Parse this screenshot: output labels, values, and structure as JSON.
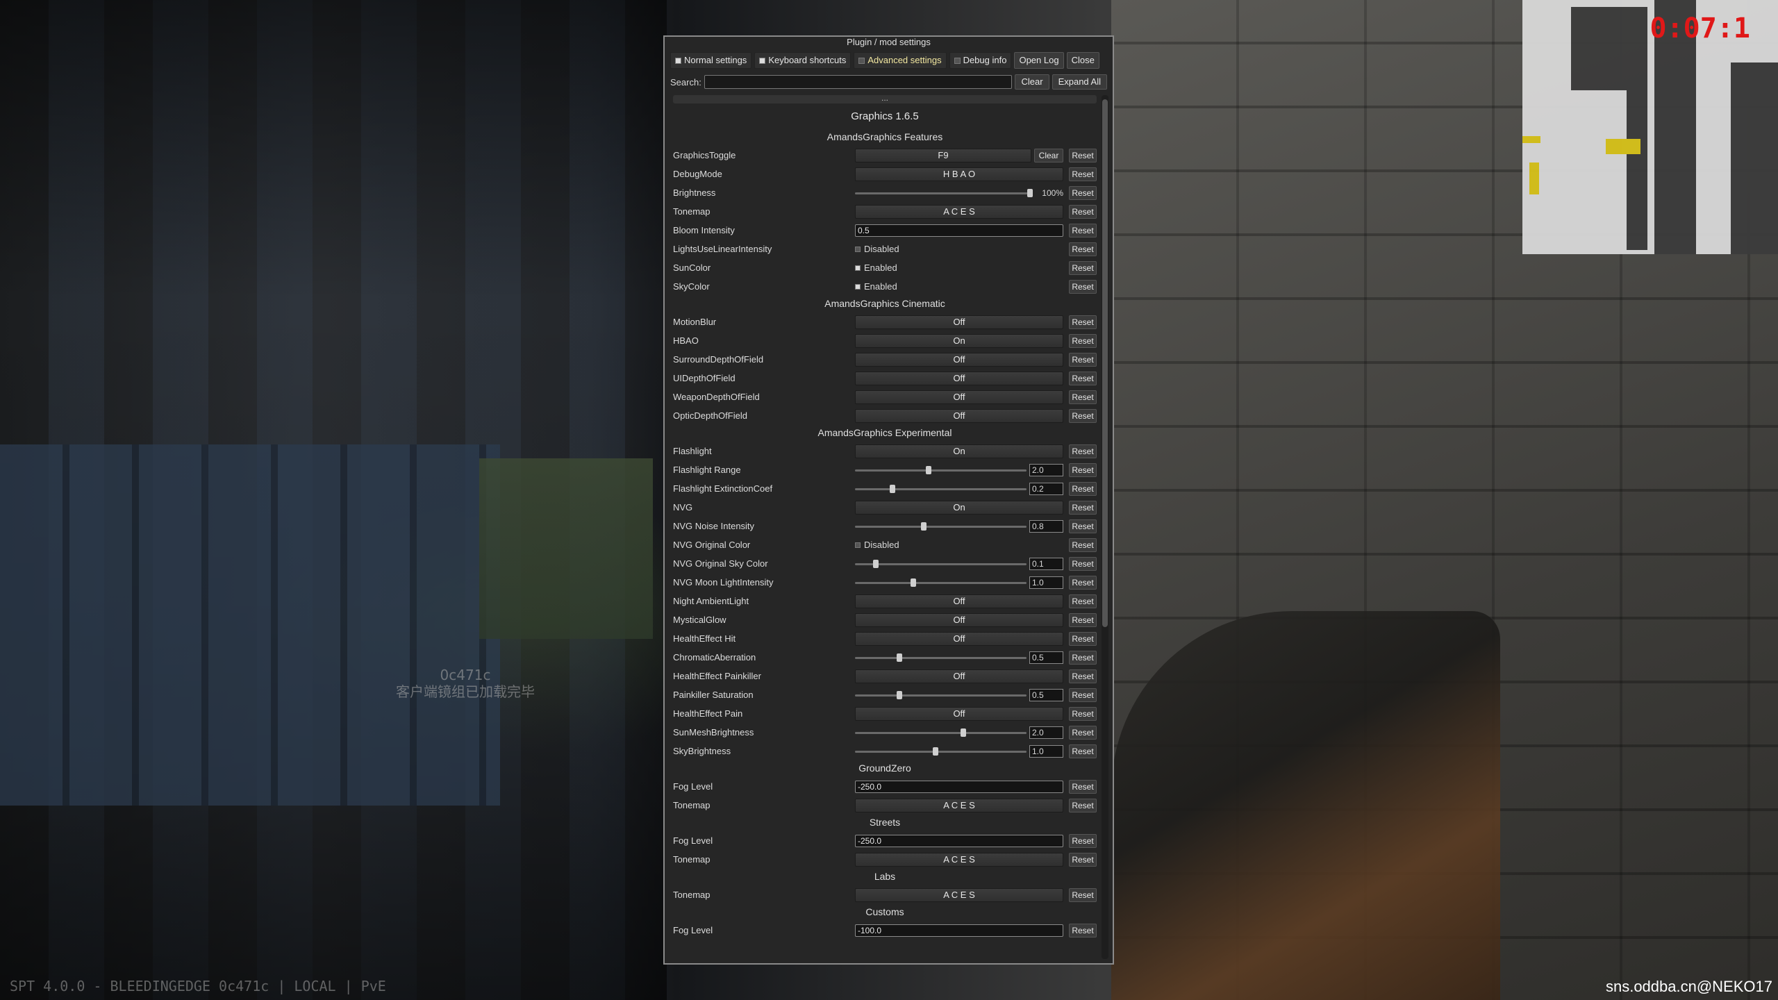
{
  "window": {
    "title": "Plugin / mod settings"
  },
  "tabs": [
    {
      "label": "Normal settings",
      "checked": true,
      "active": false
    },
    {
      "label": "Keyboard shortcuts",
      "checked": true,
      "active": false
    },
    {
      "label": "Advanced settings",
      "checked": false,
      "active": true
    },
    {
      "label": "Debug info",
      "checked": false,
      "active": false
    }
  ],
  "buttons": {
    "open_log": "Open Log",
    "close": "Close",
    "clear": "Clear",
    "expand_all": "Expand All",
    "reset": "Reset"
  },
  "search": {
    "label": "Search:",
    "value": ""
  },
  "plugin_title": "Graphics 1.6.5",
  "dots": "...",
  "sections": [
    {
      "title": "AmandsGraphics Features",
      "rows": [
        {
          "label": "GraphicsToggle",
          "type": "key",
          "value": "F9",
          "clear": "Clear"
        },
        {
          "label": "DebugMode",
          "type": "dropdown",
          "value": "H B A O"
        },
        {
          "label": "Brightness",
          "type": "slider",
          "value": 1.0,
          "display": "100%",
          "mode": "pct"
        },
        {
          "label": "Tonemap",
          "type": "dropdown",
          "value": "A C E S"
        },
        {
          "label": "Bloom Intensity",
          "type": "text",
          "value": "0.5"
        },
        {
          "label": "LightsUseLinearIntensity",
          "type": "check",
          "checked": false,
          "value": "Disabled"
        },
        {
          "label": "SunColor",
          "type": "check",
          "checked": true,
          "value": "Enabled"
        },
        {
          "label": "SkyColor",
          "type": "check",
          "checked": true,
          "value": "Enabled"
        }
      ]
    },
    {
      "title": "AmandsGraphics Cinematic",
      "rows": [
        {
          "label": "MotionBlur",
          "type": "dropdown",
          "value": "Off"
        },
        {
          "label": "HBAO",
          "type": "dropdown",
          "value": "On"
        },
        {
          "label": "SurroundDepthOfField",
          "type": "dropdown",
          "value": "Off"
        },
        {
          "label": "UIDepthOfField",
          "type": "dropdown",
          "value": "Off"
        },
        {
          "label": "WeaponDepthOfField",
          "type": "dropdown",
          "value": "Off"
        },
        {
          "label": "OpticDepthOfField",
          "type": "dropdown",
          "value": "Off"
        }
      ]
    },
    {
      "title": "AmandsGraphics Experimental",
      "rows": [
        {
          "label": "Flashlight",
          "type": "dropdown",
          "value": "On"
        },
        {
          "label": "Flashlight Range",
          "type": "slider",
          "value": 0.43,
          "display": "2.0"
        },
        {
          "label": "Flashlight ExtinctionCoef",
          "type": "slider",
          "value": 0.22,
          "display": "0.2"
        },
        {
          "label": "NVG",
          "type": "dropdown",
          "value": "On"
        },
        {
          "label": "NVG Noise Intensity",
          "type": "slider",
          "value": 0.4,
          "display": "0.8"
        },
        {
          "label": "NVG Original Color",
          "type": "check",
          "checked": false,
          "value": "Disabled"
        },
        {
          "label": "NVG Original Sky Color",
          "type": "slider",
          "value": 0.12,
          "display": "0.1"
        },
        {
          "label": "NVG Moon LightIntensity",
          "type": "slider",
          "value": 0.34,
          "display": "1.0"
        },
        {
          "label": "Night AmbientLight",
          "type": "dropdown",
          "value": "Off"
        },
        {
          "label": "MysticalGlow",
          "type": "dropdown",
          "value": "Off"
        },
        {
          "label": "HealthEffect Hit",
          "type": "dropdown",
          "value": "Off"
        },
        {
          "label": "ChromaticAberration",
          "type": "slider",
          "value": 0.26,
          "display": "0.5"
        },
        {
          "label": "HealthEffect Painkiller",
          "type": "dropdown",
          "value": "Off"
        },
        {
          "label": "Painkiller Saturation",
          "type": "slider",
          "value": 0.26,
          "display": "0.5"
        },
        {
          "label": "HealthEffect Pain",
          "type": "dropdown",
          "value": "Off"
        },
        {
          "label": "SunMeshBrightness",
          "type": "slider",
          "value": 0.63,
          "display": "2.0"
        },
        {
          "label": "SkyBrightness",
          "type": "slider",
          "value": 0.47,
          "display": "1.0"
        }
      ]
    },
    {
      "title": "GroundZero",
      "rows": [
        {
          "label": "Fog Level",
          "type": "text",
          "value": "-250.0"
        },
        {
          "label": "Tonemap",
          "type": "dropdown",
          "value": "A C E S"
        }
      ]
    },
    {
      "title": "Streets",
      "rows": [
        {
          "label": "Fog Level",
          "type": "text",
          "value": "-250.0"
        },
        {
          "label": "Tonemap",
          "type": "dropdown",
          "value": "A C E S"
        }
      ]
    },
    {
      "title": "Labs",
      "rows": [
        {
          "label": "Tonemap",
          "type": "dropdown",
          "value": "A C E S"
        }
      ]
    },
    {
      "title": "Customs",
      "rows": [
        {
          "label": "Fog Level",
          "type": "text",
          "value": "-100.0"
        }
      ]
    }
  ],
  "hud": {
    "timer": "0:07:1",
    "watermark_line1": "0c471c",
    "watermark_line2": "客户端镜组已加载完毕",
    "footer_left": "SPT 4.0.0 - BLEEDINGEDGE 0c471c | LOCAL | PvE",
    "footer_right": "sns.oddba.cn@NEKO17"
  }
}
